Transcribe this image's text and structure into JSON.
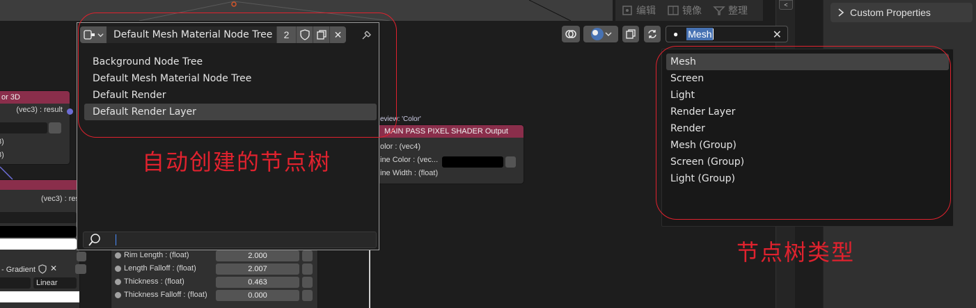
{
  "mode_toolbar": {
    "edit": "编辑",
    "mirror": "镜像",
    "tidy": "整理"
  },
  "properties": {
    "custom_properties": "Custom Properties"
  },
  "tree_popup": {
    "tree_name": "Default Mesh Material Node Tree",
    "user_count": "2",
    "items": [
      "Background Node Tree",
      "Default Mesh Material Node Tree",
      "Default Render",
      "Default Render Layer"
    ],
    "active_index": 3,
    "search_value": ""
  },
  "search": {
    "value": "Mesh"
  },
  "type_list": {
    "items": [
      "Mesh",
      "Screen",
      "Light",
      "Render Layer",
      "Render",
      "Mesh (Group)",
      "Screen (Group)",
      "Light (Group)"
    ],
    "active_index": 0
  },
  "annotations": {
    "tree_note": "自动创建的节点树",
    "type_note": "节点树类型"
  },
  "nodes": {
    "left_top": {
      "title": "or 3D",
      "output": "(vec3) : result",
      "row1": "3)",
      "row2": "3)"
    },
    "left_mid": {
      "output": "(vec3) : res"
    },
    "left_bottom": {
      "gradient_label": "- Gradient",
      "interp": "Linear"
    },
    "shader_output": {
      "preview": "eview: 'Color'",
      "title": "MAIN PASS PIXEL SHADER Output",
      "rows": [
        "olor : (vec4)",
        "ine Color : (vec...",
        "ine Width : (float)"
      ]
    },
    "rim": {
      "rows": [
        {
          "label": "Rim Length : (float)",
          "value": "2.000"
        },
        {
          "label": "Length Falloff : (float)",
          "value": "2.007"
        },
        {
          "label": "Thickness : (float)",
          "value": "0.463"
        },
        {
          "label": "Thickness Falloff : (float)",
          "value": "0.000"
        }
      ]
    }
  },
  "colors": {
    "accent": "#4772b3",
    "node_header": "#8a2e4b",
    "annotation": "#e0222e"
  }
}
